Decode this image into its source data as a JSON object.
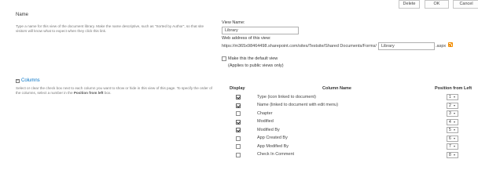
{
  "toolbar": {
    "delete_label": "Delete",
    "ok_label": "OK",
    "cancel_label": "Cancel"
  },
  "name_section": {
    "title": "Name",
    "description": "Type a name for this view of the document library. Make the name descriptive, such as \"Sorted by Author\", so that site visitors will know what to expect when they click this link.",
    "view_name_label": "View Name:",
    "view_name_value": "Library",
    "web_address_label": "Web address of this view:",
    "url_prefix": "https://m365x98464498.sharepoint.com/sites/Testsite/Shared Documents/Forms/",
    "url_page_value": "Library",
    "url_suffix": ".aspx",
    "default_view_label": "Make this the default view",
    "default_view_note": "(Applies to public views only)",
    "rss_icon": "rss-feed-icon"
  },
  "columns_section": {
    "title": "Columns",
    "description_part1": "Select or clear the check box next to each column you want to show or hide in this view of this page. To specify the order of the columns, select a number in the",
    "description_bold": "Position from left",
    "description_part2": "box.",
    "headers": {
      "display": "Display",
      "column_name": "Column Name",
      "position": "Position from Left"
    },
    "rows": [
      {
        "checked": true,
        "name": "Type (icon linked to document)",
        "position": "1"
      },
      {
        "checked": true,
        "name": "Name (linked to document with edit menu)",
        "position": "2"
      },
      {
        "checked": false,
        "name": "Chapter",
        "position": "3"
      },
      {
        "checked": true,
        "name": "Modified",
        "position": "4"
      },
      {
        "checked": true,
        "name": "Modified By",
        "position": "5"
      },
      {
        "checked": false,
        "name": "App Created By",
        "position": "6"
      },
      {
        "checked": false,
        "name": "App Modified By",
        "position": "7"
      },
      {
        "checked": false,
        "name": "Check In Comment",
        "position": "8"
      }
    ]
  }
}
